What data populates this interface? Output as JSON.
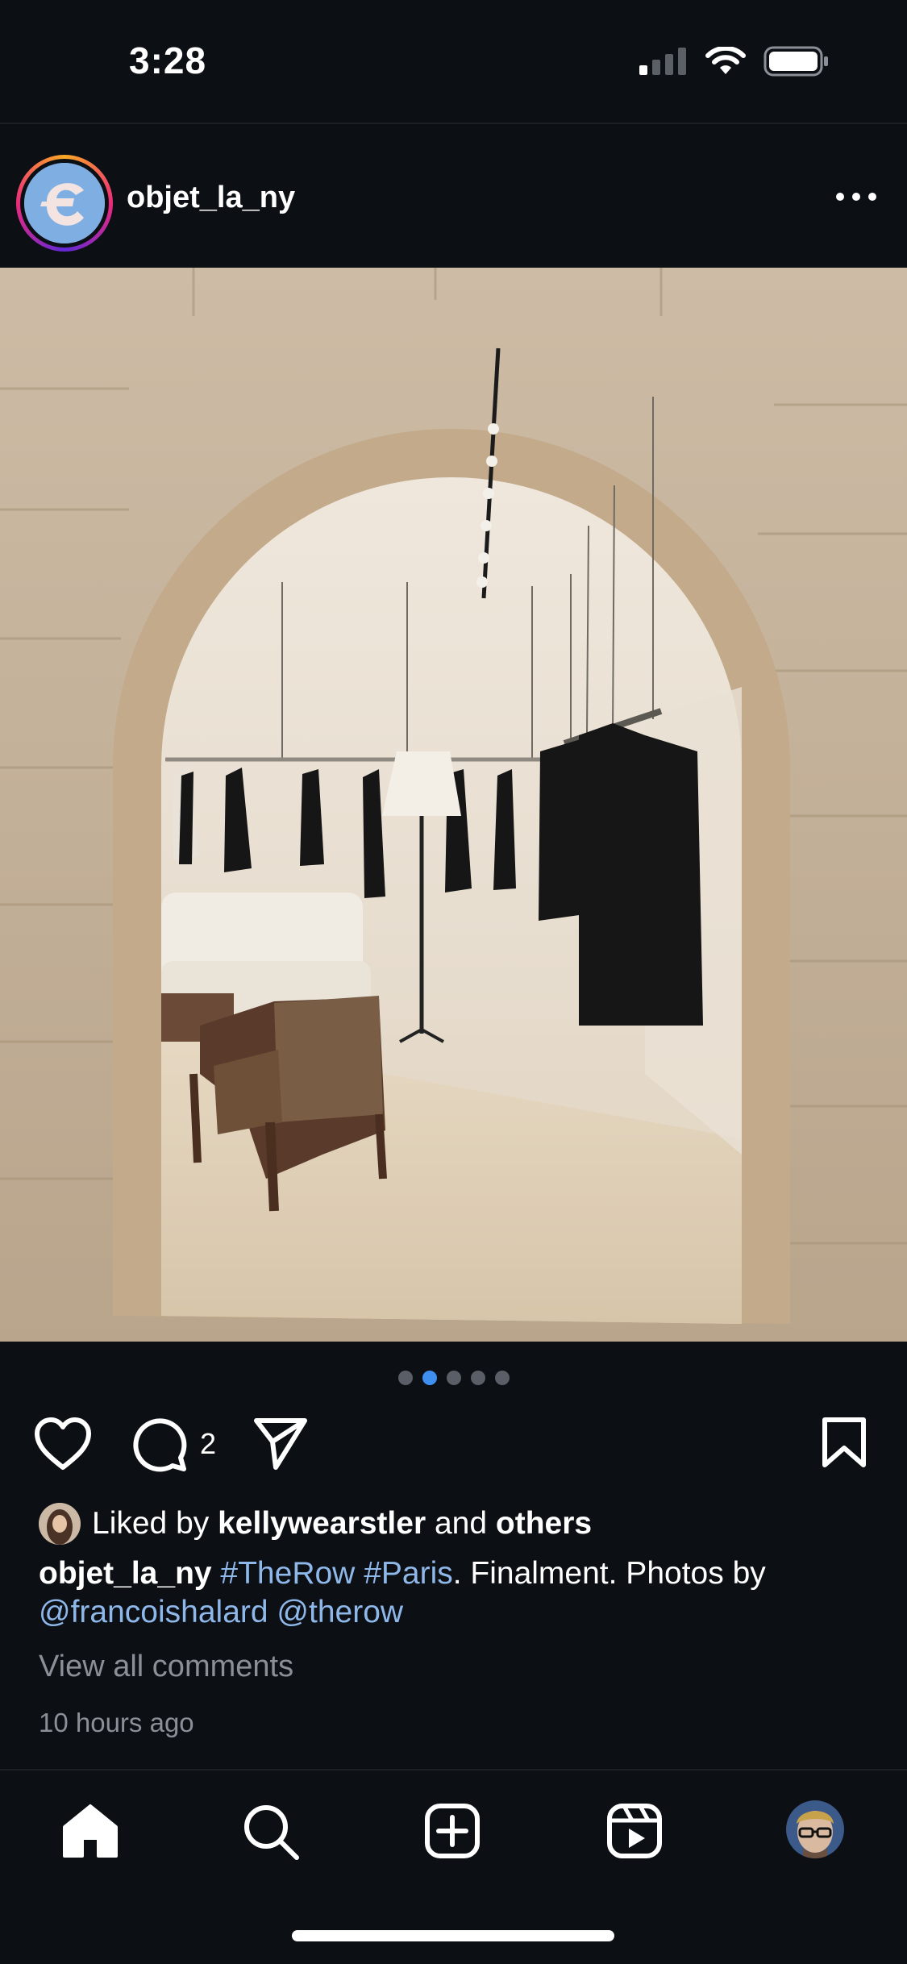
{
  "status_bar": {
    "time": "3:28",
    "icons": [
      "cellular-signal-icon",
      "wifi-icon",
      "battery-icon"
    ]
  },
  "post": {
    "username": "objet_la_ny",
    "more_icon": "more-horizontal-icon",
    "carousel": {
      "count": 5,
      "active_index": 1
    },
    "comment_count": "2",
    "liked_by": {
      "prefix": "Liked by",
      "user": "kellywearstler",
      "conjunction": "and",
      "others": "others"
    },
    "caption": {
      "username": "objet_la_ny",
      "hashtag1": "#TheRow",
      "hashtag2": "#Paris",
      "text": ". Finalment. Photos by",
      "mention1": "@francoishalard",
      "mention2": "@therow"
    },
    "view_comments": "View all comments",
    "timestamp": "10 hours ago"
  },
  "bottom_nav": {
    "items": [
      "home-icon",
      "search-icon",
      "create-post-icon",
      "reels-icon",
      "profile-avatar"
    ]
  },
  "colors": {
    "background": "#0c0f14",
    "link": "#8fb8ea",
    "muted": "#8a8f98",
    "active_dot": "#3f8ff1"
  }
}
